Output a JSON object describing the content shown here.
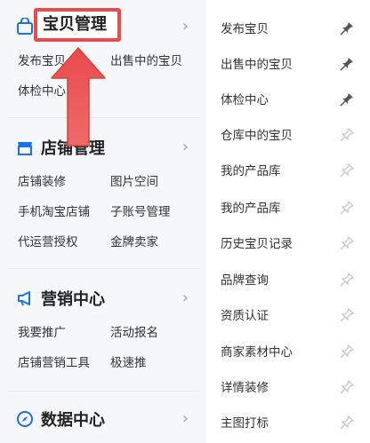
{
  "sections": [
    {
      "id": "baobei",
      "title": "宝贝管理",
      "icon": "shopping-bag-icon",
      "links": [
        "发布宝贝",
        "出售中的宝贝",
        "体检中心"
      ]
    },
    {
      "id": "dianpu",
      "title": "店铺管理",
      "icon": "store-icon",
      "links": [
        "店铺装修",
        "图片空间",
        "手机淘宝店铺",
        "子账号管理",
        "代运营授权",
        "金牌卖家"
      ]
    },
    {
      "id": "yingxiao",
      "title": "营销中心",
      "icon": "megaphone-icon",
      "links": [
        "我要推广",
        "活动报名",
        "店铺营销工具",
        "极速推"
      ]
    },
    {
      "id": "shuju",
      "title": "数据中心",
      "icon": "compass-icon",
      "links": []
    }
  ],
  "right_menu": [
    {
      "label": "发布宝贝",
      "pinned": true
    },
    {
      "label": "出售中的宝贝",
      "pinned": true
    },
    {
      "label": "体检中心",
      "pinned": true
    },
    {
      "label": "仓库中的宝贝",
      "pinned": false
    },
    {
      "label": "我的产品库",
      "pinned": false
    },
    {
      "label": "我的产品库",
      "pinned": false
    },
    {
      "label": "历史宝贝记录",
      "pinned": false
    },
    {
      "label": "品牌查询",
      "pinned": false
    },
    {
      "label": "资质认证",
      "pinned": false
    },
    {
      "label": "商家素材中心",
      "pinned": false
    },
    {
      "label": "详情装修",
      "pinned": false
    },
    {
      "label": "主图打标",
      "pinned": false
    }
  ],
  "colors": {
    "accent": "#1a73e8",
    "highlight": "#e84c4c",
    "pin_active": "#555555",
    "pin_inactive": "#c4c8cc"
  }
}
